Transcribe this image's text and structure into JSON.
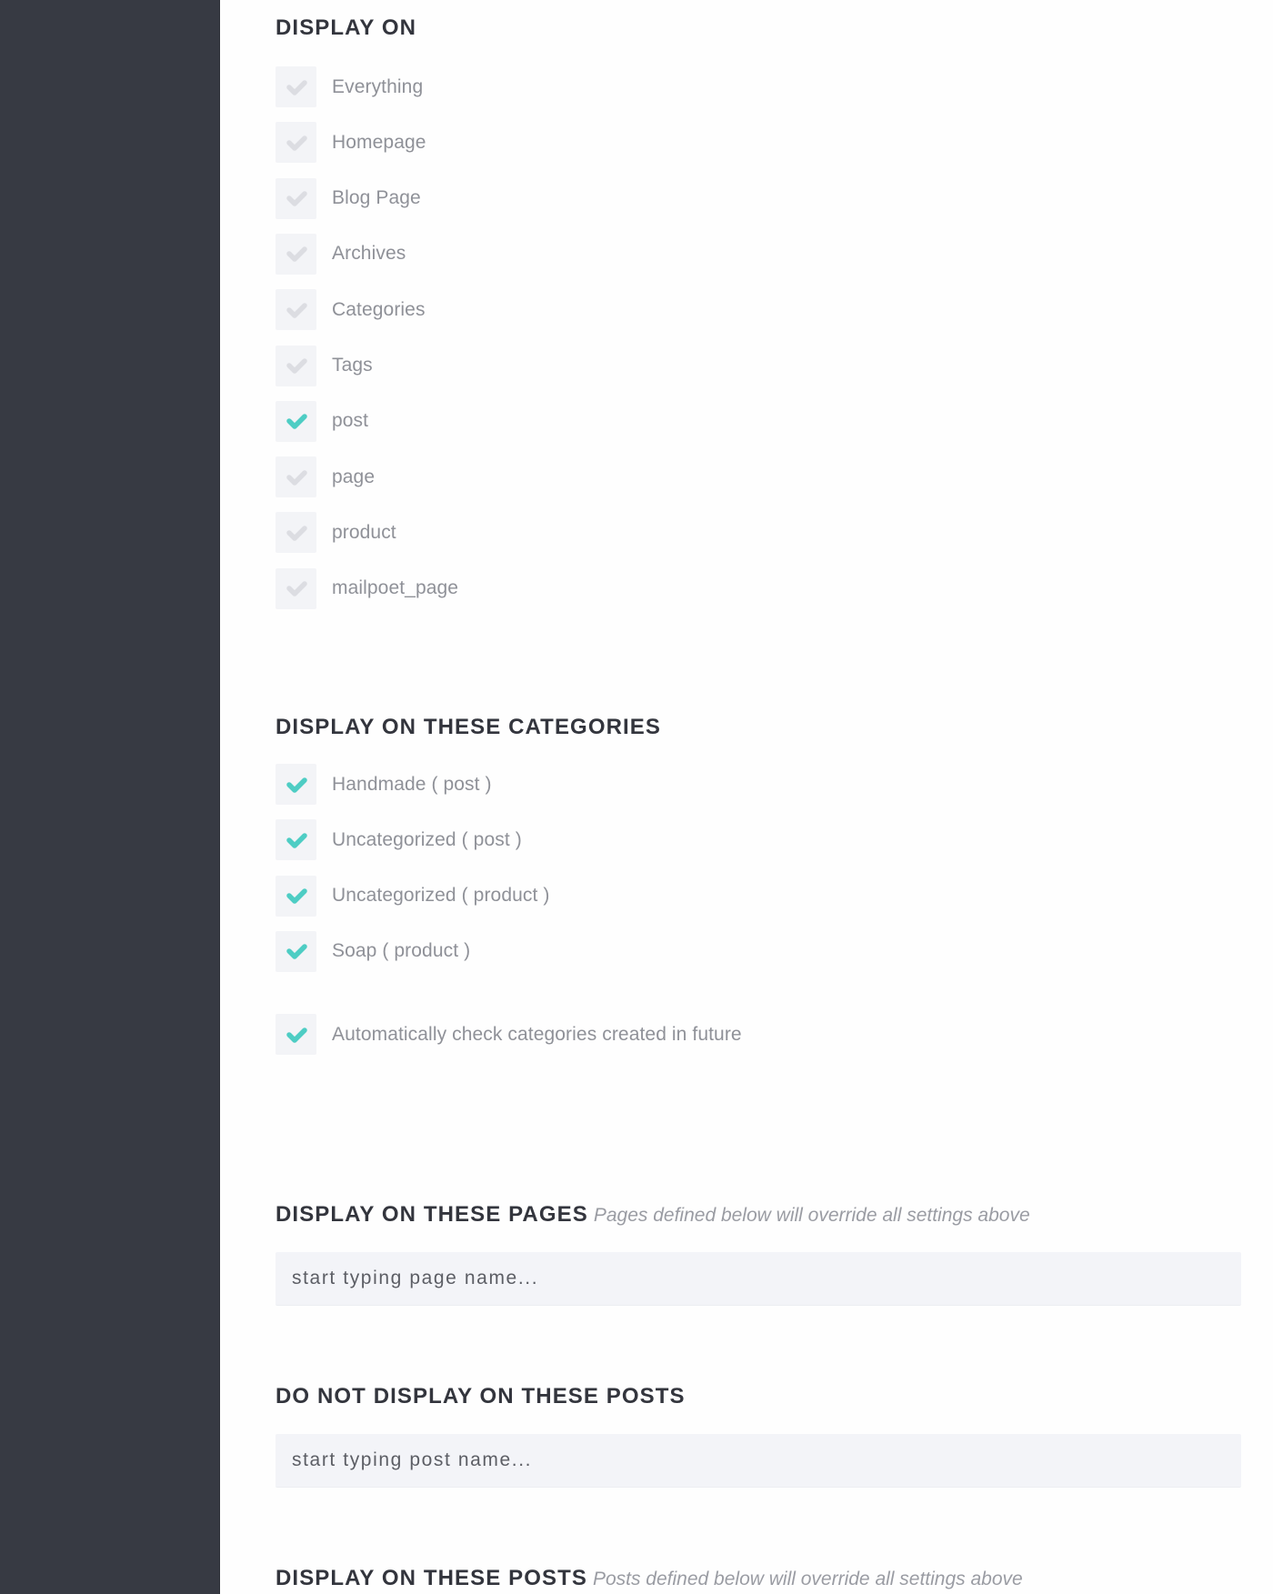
{
  "colors": {
    "sidebar_bg": "#373a43",
    "accent_check": "#4ecdc4",
    "unchecked_glyph": "#dcdde2",
    "checkbox_bg": "#f3f4f7",
    "heading": "#33353d",
    "label": "#8f9198",
    "input_bg": "#f3f4f8"
  },
  "display_on": {
    "heading": "DISPLAY ON",
    "options": [
      {
        "label": "Everything",
        "checked": false
      },
      {
        "label": "Homepage",
        "checked": false
      },
      {
        "label": "Blog Page",
        "checked": false
      },
      {
        "label": "Archives",
        "checked": false
      },
      {
        "label": "Categories",
        "checked": false
      },
      {
        "label": "Tags",
        "checked": false
      },
      {
        "label": "post",
        "checked": true
      },
      {
        "label": "page",
        "checked": false
      },
      {
        "label": "product",
        "checked": false
      },
      {
        "label": "mailpoet_page",
        "checked": false
      }
    ]
  },
  "categories": {
    "heading": "DISPLAY ON THESE CATEGORIES",
    "options": [
      {
        "label": "Handmade ( post )",
        "checked": true
      },
      {
        "label": "Uncategorized ( post )",
        "checked": true
      },
      {
        "label": "Uncategorized ( product )",
        "checked": true
      },
      {
        "label": "Soap ( product )",
        "checked": true
      }
    ],
    "auto_check": {
      "label": "Automatically check categories created in future",
      "checked": true
    }
  },
  "pages": {
    "heading": "DISPLAY ON THESE PAGES",
    "note": "Pages defined below will override all settings above",
    "input_value": "",
    "input_placeholder": "start typing page name..."
  },
  "exclude_posts": {
    "heading": "DO NOT DISPLAY ON THESE POSTS",
    "input_value": "",
    "input_placeholder": "start typing post name..."
  },
  "posts": {
    "heading": "DISPLAY ON THESE POSTS",
    "note": "Posts defined below will override all settings above"
  }
}
